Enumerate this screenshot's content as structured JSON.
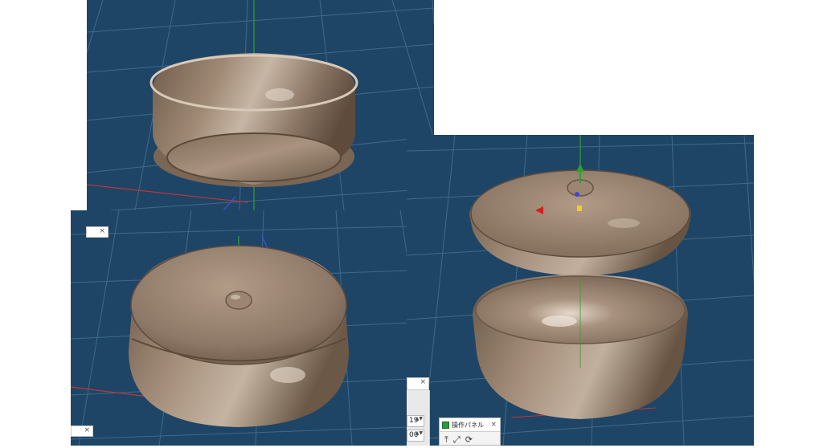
{
  "viewports": {
    "colors": {
      "background": "#1f4566",
      "grid": "#3d6a8c",
      "axis_y": "#2fa02f",
      "axis_x": "#c03535",
      "axis_z": "#4650d8",
      "wood_light": "#b09a86",
      "wood_dark": "#6f5b4b"
    }
  },
  "panels": {
    "close_glyph": "×",
    "spinner_1_value": "19",
    "spinner_2_value": "00",
    "spin_arrows": "▲▼",
    "operation_panel": {
      "title": "操作パネル",
      "tools": [
        "⤒",
        "⤢",
        "⟳"
      ]
    }
  }
}
